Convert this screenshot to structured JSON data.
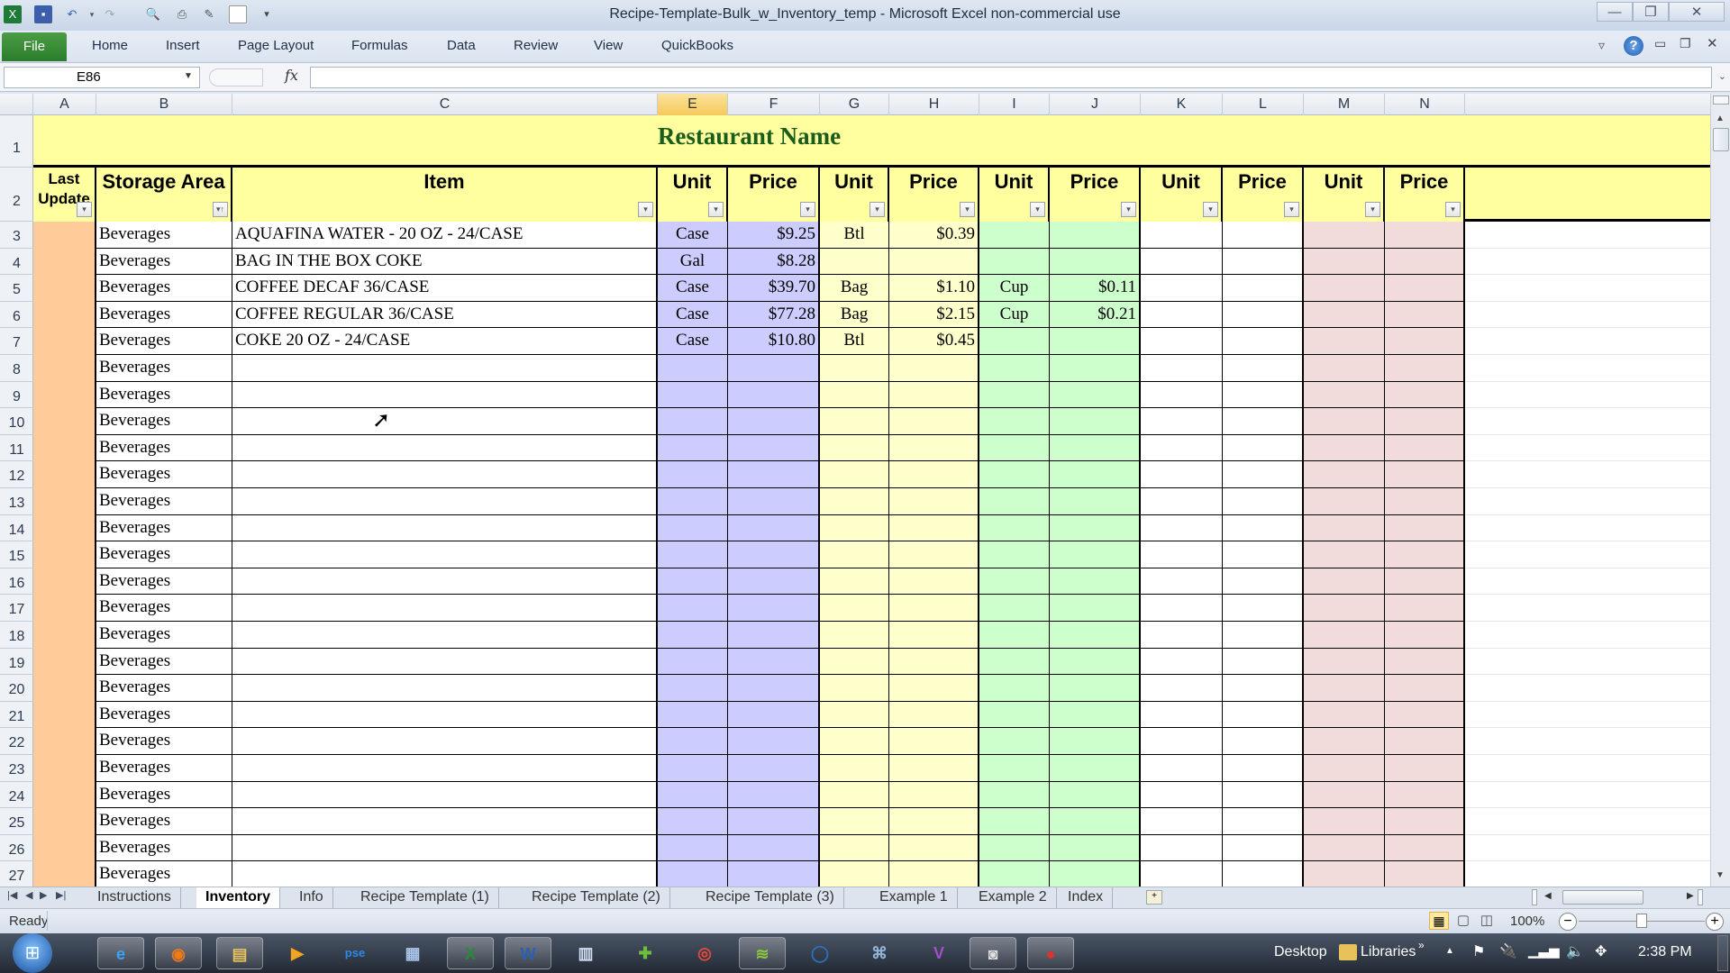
{
  "window": {
    "title": "Recipe-Template-Bulk_w_Inventory_temp  -  Microsoft Excel non-commercial use",
    "controls": {
      "minimize": "—",
      "restore": "❐",
      "close": "✕"
    }
  },
  "quick_access": [
    "excel-logo",
    "save",
    "undo",
    "redo",
    "print-preview",
    "print",
    "format-painter",
    "new",
    "customize"
  ],
  "ribbon": {
    "file_label": "File",
    "tabs": [
      "Home",
      "Insert",
      "Page Layout",
      "Formulas",
      "Data",
      "Review",
      "View",
      "QuickBooks"
    ]
  },
  "formula_bar": {
    "name_box": "E86",
    "fx_label": "fx",
    "formula": ""
  },
  "columns": [
    "A",
    "B",
    "C",
    "E",
    "F",
    "G",
    "H",
    "I",
    "J",
    "K",
    "L",
    "M",
    "N"
  ],
  "selected_column": "E",
  "sheet": {
    "title": "Restaurant Name",
    "headers": {
      "last_update": "Last Update",
      "storage_area": "Storage Area",
      "item": "Item",
      "unit": "Unit",
      "price": "Price"
    },
    "colors": {
      "title_bg": "#ffff9f",
      "title_text": "#1a5c1a",
      "last_update_bg": "#ffcc99",
      "group1_bg": "#ccccff",
      "group2_bg": "#ffffcc",
      "group3_bg": "#ccffcc",
      "group4_bg": "#ffffff",
      "group5_bg": "#f2dcdb"
    },
    "rows": [
      {
        "row": "3",
        "storage": "Beverages",
        "item": "AQUAFINA WATER - 20 OZ - 24/CASE",
        "u1": "Case",
        "p1": "$9.25",
        "u2": "Btl",
        "p2": "$0.39",
        "u3": "",
        "p3": ""
      },
      {
        "row": "4",
        "storage": "Beverages",
        "item": "BAG IN THE BOX COKE",
        "u1": "Gal",
        "p1": "$8.28",
        "u2": "",
        "p2": "",
        "u3": "",
        "p3": ""
      },
      {
        "row": "5",
        "storage": "Beverages",
        "item": "COFFEE DECAF 36/CASE",
        "u1": "Case",
        "p1": "$39.70",
        "u2": "Bag",
        "p2": "$1.10",
        "u3": "Cup",
        "p3": "$0.11"
      },
      {
        "row": "6",
        "storage": "Beverages",
        "item": "COFFEE REGULAR 36/CASE",
        "u1": "Case",
        "p1": "$77.28",
        "u2": "Bag",
        "p2": "$2.15",
        "u3": "Cup",
        "p3": "$0.21"
      },
      {
        "row": "7",
        "storage": "Beverages",
        "item": "COKE 20 OZ - 24/CASE",
        "u1": "Case",
        "p1": "$10.80",
        "u2": "Btl",
        "p2": "$0.45",
        "u3": "",
        "p3": ""
      },
      {
        "row": "8",
        "storage": "Beverages",
        "item": "",
        "u1": "",
        "p1": "",
        "u2": "",
        "p2": "",
        "u3": "",
        "p3": ""
      },
      {
        "row": "9",
        "storage": "Beverages",
        "item": "",
        "u1": "",
        "p1": "",
        "u2": "",
        "p2": "",
        "u3": "",
        "p3": ""
      },
      {
        "row": "10",
        "storage": "Beverages",
        "item": "",
        "u1": "",
        "p1": "",
        "u2": "",
        "p2": "",
        "u3": "",
        "p3": ""
      },
      {
        "row": "11",
        "storage": "Beverages",
        "item": "",
        "u1": "",
        "p1": "",
        "u2": "",
        "p2": "",
        "u3": "",
        "p3": ""
      },
      {
        "row": "12",
        "storage": "Beverages",
        "item": "",
        "u1": "",
        "p1": "",
        "u2": "",
        "p2": "",
        "u3": "",
        "p3": ""
      },
      {
        "row": "13",
        "storage": "Beverages",
        "item": "",
        "u1": "",
        "p1": "",
        "u2": "",
        "p2": "",
        "u3": "",
        "p3": ""
      },
      {
        "row": "14",
        "storage": "Beverages",
        "item": "",
        "u1": "",
        "p1": "",
        "u2": "",
        "p2": "",
        "u3": "",
        "p3": ""
      },
      {
        "row": "15",
        "storage": "Beverages",
        "item": "",
        "u1": "",
        "p1": "",
        "u2": "",
        "p2": "",
        "u3": "",
        "p3": ""
      },
      {
        "row": "16",
        "storage": "Beverages",
        "item": "",
        "u1": "",
        "p1": "",
        "u2": "",
        "p2": "",
        "u3": "",
        "p3": ""
      },
      {
        "row": "17",
        "storage": "Beverages",
        "item": "",
        "u1": "",
        "p1": "",
        "u2": "",
        "p2": "",
        "u3": "",
        "p3": ""
      },
      {
        "row": "18",
        "storage": "Beverages",
        "item": "",
        "u1": "",
        "p1": "",
        "u2": "",
        "p2": "",
        "u3": "",
        "p3": ""
      },
      {
        "row": "19",
        "storage": "Beverages",
        "item": "",
        "u1": "",
        "p1": "",
        "u2": "",
        "p2": "",
        "u3": "",
        "p3": ""
      },
      {
        "row": "20",
        "storage": "Beverages",
        "item": "",
        "u1": "",
        "p1": "",
        "u2": "",
        "p2": "",
        "u3": "",
        "p3": ""
      },
      {
        "row": "21",
        "storage": "Beverages",
        "item": "",
        "u1": "",
        "p1": "",
        "u2": "",
        "p2": "",
        "u3": "",
        "p3": ""
      },
      {
        "row": "22",
        "storage": "Beverages",
        "item": "",
        "u1": "",
        "p1": "",
        "u2": "",
        "p2": "",
        "u3": "",
        "p3": ""
      },
      {
        "row": "23",
        "storage": "Beverages",
        "item": "",
        "u1": "",
        "p1": "",
        "u2": "",
        "p2": "",
        "u3": "",
        "p3": ""
      },
      {
        "row": "24",
        "storage": "Beverages",
        "item": "",
        "u1": "",
        "p1": "",
        "u2": "",
        "p2": "",
        "u3": "",
        "p3": ""
      },
      {
        "row": "25",
        "storage": "Beverages",
        "item": "",
        "u1": "",
        "p1": "",
        "u2": "",
        "p2": "",
        "u3": "",
        "p3": ""
      },
      {
        "row": "26",
        "storage": "Beverages",
        "item": "",
        "u1": "",
        "p1": "",
        "u2": "",
        "p2": "",
        "u3": "",
        "p3": ""
      },
      {
        "row": "27",
        "storage": "Beverages",
        "item": "",
        "u1": "",
        "p1": "",
        "u2": "",
        "p2": "",
        "u3": "",
        "p3": ""
      }
    ]
  },
  "sheet_tabs": [
    "Instructions",
    "Inventory",
    "Info",
    "Recipe Template (1)",
    "Recipe Template (2)",
    "Recipe Template (3)",
    "Example 1",
    "Example 2",
    "Index"
  ],
  "active_sheet": "Inventory",
  "status": {
    "text": "Ready",
    "zoom": "100%",
    "zoom_level_percent": 100
  },
  "taskbar": {
    "apps": [
      "start",
      "internet-explorer",
      "firefox",
      "file-explorer",
      "media-player",
      "photoshop-elements",
      "calculator",
      "excel",
      "word",
      "notepad",
      "spreadsheet-app",
      "chrome",
      "spotify",
      "disc-app",
      "terminal",
      "visual-studio",
      "camera",
      "recorder"
    ],
    "toolbars": [
      "Desktop",
      "Libraries"
    ],
    "clock": "2:38 PM"
  }
}
